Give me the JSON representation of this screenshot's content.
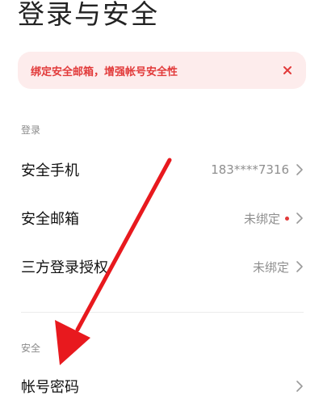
{
  "page": {
    "title": "登录与安全"
  },
  "banner": {
    "text": "绑定安全邮箱，增强帐号安全性",
    "close_icon": "close-icon",
    "accent_color": "#e23a3a",
    "background_color": "#fdecec"
  },
  "sections": {
    "login": {
      "label": "登录",
      "items": [
        {
          "label": "安全手机",
          "value": "183****7316"
        },
        {
          "label": "安全邮箱",
          "value": "未绑定",
          "has_red_dot": true
        },
        {
          "label": "三方登录授权",
          "value": "未绑定"
        }
      ]
    },
    "security": {
      "label": "安全",
      "items": [
        {
          "label": "帐号密码",
          "value": ""
        }
      ]
    }
  },
  "icons": {
    "chevron": "chevron-right-icon"
  },
  "annotation": {
    "arrow_color": "#e8191e"
  }
}
